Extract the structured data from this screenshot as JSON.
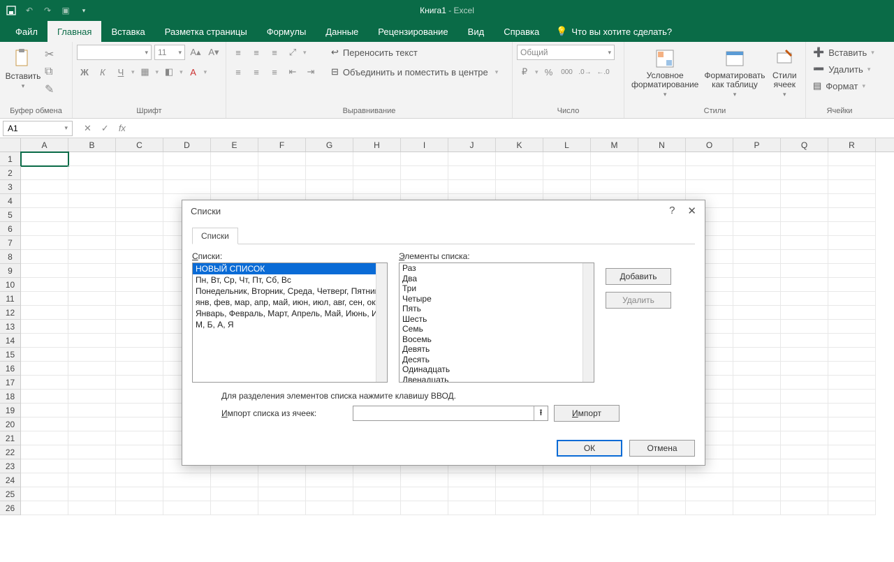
{
  "title": {
    "book": "Книга1",
    "app": "Excel"
  },
  "tabs": {
    "file": "Файл",
    "home": "Главная",
    "insert": "Вставка",
    "layout": "Разметка страницы",
    "formulas": "Формулы",
    "data": "Данные",
    "review": "Рецензирование",
    "view": "Вид",
    "help": "Справка",
    "tell_me": "Что вы хотите сделать?"
  },
  "ribbon": {
    "clipboard": {
      "paste": "Вставить",
      "group": "Буфер обмена"
    },
    "font": {
      "size": "11",
      "group": "Шрифт"
    },
    "alignment": {
      "wrap": "Переносить текст",
      "merge": "Объединить и поместить в центре",
      "group": "Выравнивание"
    },
    "number": {
      "format": "Общий",
      "group": "Число"
    },
    "styles": {
      "cond": "Условное форматирование",
      "table": "Форматировать как таблицу",
      "cell": "Стили ячеек",
      "group": "Стили"
    },
    "cells": {
      "insert": "Вставить",
      "delete": "Удалить",
      "format": "Формат",
      "group": "Ячейки"
    }
  },
  "namebox": "A1",
  "columns": [
    "A",
    "B",
    "C",
    "D",
    "E",
    "F",
    "G",
    "H",
    "I",
    "J",
    "K",
    "L",
    "M",
    "N",
    "O",
    "P",
    "Q",
    "R"
  ],
  "rows": [
    "1",
    "2",
    "3",
    "4",
    "5",
    "6",
    "7",
    "8",
    "9",
    "10",
    "11",
    "12",
    "13",
    "14",
    "15",
    "16",
    "17",
    "18",
    "19",
    "20",
    "21",
    "22",
    "23",
    "24",
    "25",
    "26"
  ],
  "dialog": {
    "title": "Списки",
    "tab": "Списки",
    "lists_label": "Списки:",
    "entries_label": "Элементы списка:",
    "lists": [
      "НОВЫЙ СПИСОК",
      "Пн, Вт, Ср, Чт, Пт, Сб, Вс",
      "Понедельник, Вторник, Среда, Четверг, Пятница, Суббота, Воскресенье",
      "янв, фев, мар, апр, май, июн, июл, авг, сен, окт, ноя, дек",
      "Январь, Февраль, Март, Апрель, Май, Июнь, Июль, Август, Сентябрь, Октябрь, Ноябрь, Декабрь",
      "М, Б, А, Я"
    ],
    "entries": [
      "Раз",
      "Два",
      "Три",
      "Четыре",
      "Пять",
      "Шесть",
      "Семь",
      "Восемь",
      "Девять",
      "Десять",
      "Одинадцать",
      "Двенадцать"
    ],
    "add": "Добавить",
    "delete": "Удалить",
    "hint": "Для разделения элементов списка нажмите клавишу ВВОД.",
    "import_label": "Импорт списка из ячеек:",
    "import": "Импорт",
    "ok": "ОК",
    "cancel": "Отмена"
  }
}
